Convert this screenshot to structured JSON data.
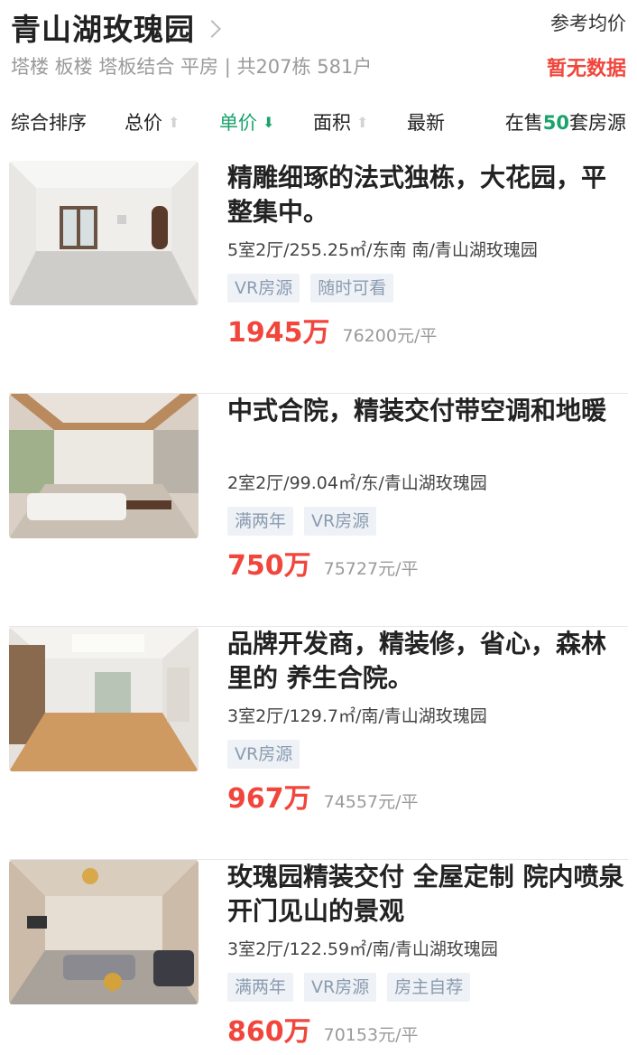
{
  "header": {
    "title": "青山湖玫瑰园",
    "subtitle": "塔楼 板楼 塔板结合 平房 | 共207栋 581户",
    "ref_label": "参考均价",
    "ref_value": "暂无数据"
  },
  "sort": {
    "items": [
      {
        "label": "综合排序",
        "arrow": ""
      },
      {
        "label": "总价",
        "arrow": "⬆"
      },
      {
        "label": "单价",
        "arrow": "⬇"
      },
      {
        "label": "面积",
        "arrow": "⬆"
      },
      {
        "label": "最新",
        "arrow": ""
      }
    ],
    "active_index": 2,
    "count_prefix": "在售",
    "count_num": "50",
    "count_suffix": "套房源"
  },
  "listings": [
    {
      "title": "精雕细琢的法式独栋，大花园，平整集中。",
      "desc": "5室2厅/255.25㎡/东南 南/青山湖玫瑰园",
      "tags": [
        "VR房源",
        "随时可看"
      ],
      "price": "1945万",
      "unit_price": "76200元/平"
    },
    {
      "title": "中式合院，精装交付带空调和地暖",
      "desc": "2室2厅/99.04㎡/东/青山湖玫瑰园",
      "tags": [
        "满两年",
        "VR房源"
      ],
      "price": "750万",
      "unit_price": "75727元/平"
    },
    {
      "title": "品牌开发商，精装修，省心，森林里的 养生合院。",
      "desc": "3室2厅/129.7㎡/南/青山湖玫瑰园",
      "tags": [
        "VR房源"
      ],
      "price": "967万",
      "unit_price": "74557元/平"
    },
    {
      "title": "玫瑰园精装交付 全屋定制 院内喷泉 开门见山的景观",
      "desc": "3室2厅/122.59㎡/南/青山湖玫瑰园",
      "tags": [
        "满两年",
        "VR房源",
        "房主自荐"
      ],
      "price": "860万",
      "unit_price": "70153元/平"
    }
  ],
  "colors": {
    "accent_green": "#1aa36a",
    "price_red": "#f0463c",
    "tag_bg": "#eef2f6",
    "tag_text": "#8a9bb0"
  }
}
